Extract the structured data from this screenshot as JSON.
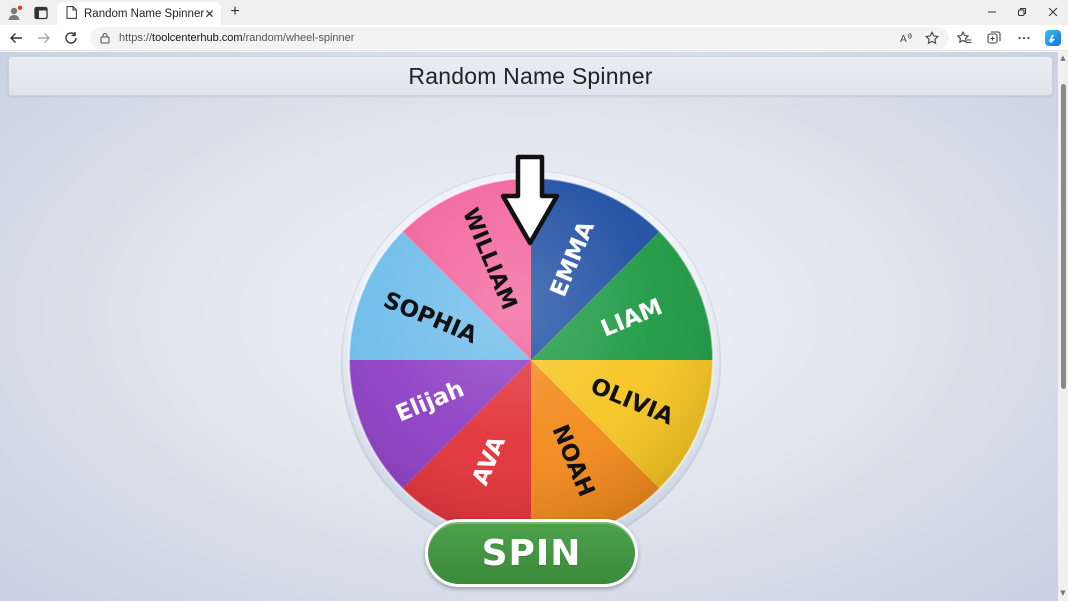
{
  "browser": {
    "tab_title": "Random Name Spinner",
    "url_prefix": "https://",
    "url_host": "toolcenterhub.com",
    "url_path": "/random/wheel-spinner",
    "icons": [
      "profile-icon",
      "tab-actions-icon",
      "page-icon",
      "close-icon",
      "new-tab-icon",
      "minimize-icon",
      "restore-icon",
      "window-close-icon",
      "back-icon",
      "forward-icon",
      "refresh-icon",
      "lock-icon",
      "read-aloud-icon",
      "favorite-icon",
      "favorites-icon",
      "collections-icon",
      "more-icon",
      "copilot-icon"
    ]
  },
  "page": {
    "title": "Random Name Spinner",
    "spin_label": "SPIN"
  },
  "wheel": {
    "segments": [
      {
        "label": "EMMA",
        "color": "#1f4fa3",
        "text_color": "#ffffff"
      },
      {
        "label": "LIAM",
        "color": "#1f9a44",
        "text_color": "#ffffff"
      },
      {
        "label": "OLIVIA",
        "color": "#f6c522",
        "text_color": "#111111"
      },
      {
        "label": "NOAH",
        "color": "#f28a1c",
        "text_color": "#111111"
      },
      {
        "label": "AVA",
        "color": "#e2333a",
        "text_color": "#ffffff"
      },
      {
        "label": "Elijah",
        "color": "#8e3fc4",
        "text_color": "#ffffff"
      },
      {
        "label": "SOPHIA",
        "color": "#6fbdea",
        "text_color": "#111111"
      },
      {
        "label": "WILLIAM",
        "color": "#f2649a",
        "text_color": "#111111"
      }
    ],
    "pointer": "down-arrow-pointer"
  },
  "colors": {
    "spin_button": "#43964a",
    "header_bg": "#e4e9f0"
  }
}
